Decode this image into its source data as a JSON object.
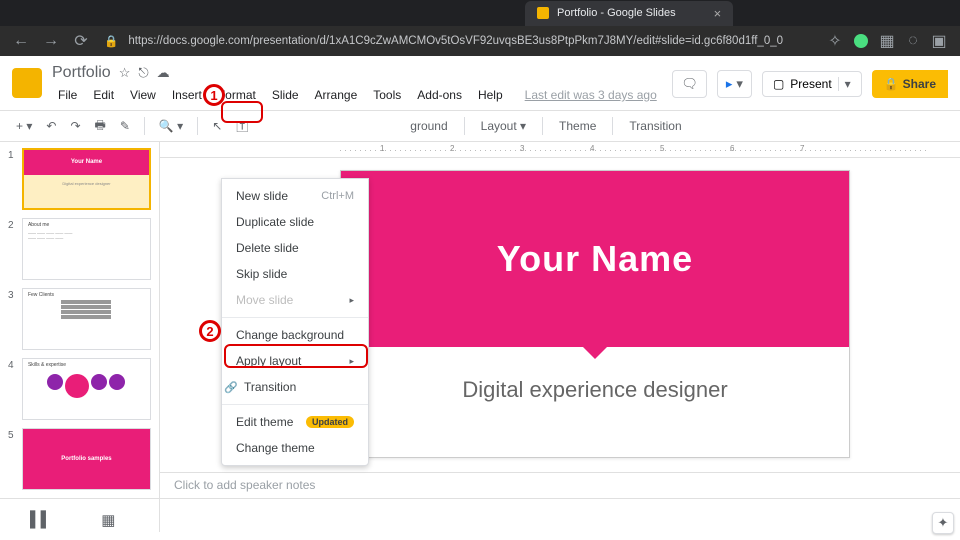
{
  "browser": {
    "tab_title": "Portfolio - Google Slides",
    "url": "https://docs.google.com/presentation/d/1xA1C9cZwAMCMOv5tOsVF92uvqsBE3us8PtpPkm7J8MY/edit#slide=id.gc6f80d1ff_0_0"
  },
  "app": {
    "doc_title": "Portfolio",
    "menus": [
      "File",
      "Edit",
      "View",
      "Insert",
      "Format",
      "Slide",
      "Arrange",
      "Tools",
      "Add-ons",
      "Help"
    ],
    "last_edit": "Last edit was 3 days ago",
    "present_label": "Present",
    "share_label": "Share"
  },
  "toolbar": {
    "background": "ground",
    "layout": "Layout",
    "theme": "Theme",
    "transition": "Transition"
  },
  "dropdown": {
    "new_slide": "New slide",
    "new_slide_shortcut": "Ctrl+M",
    "duplicate": "Duplicate slide",
    "delete": "Delete slide",
    "skip": "Skip slide",
    "move": "Move slide",
    "change_bg": "Change background",
    "apply_layout": "Apply layout",
    "transition": "Transition",
    "edit_theme": "Edit theme",
    "edit_theme_badge": "Updated",
    "change_theme": "Change theme"
  },
  "slide": {
    "title": "Your Name",
    "subtitle": "Digital experience designer"
  },
  "thumbs": {
    "t1_title": "Your Name",
    "t1_sub": "Digital experience designer",
    "t2_h": "About me",
    "t3_h": "Few Clients",
    "t4_h": "Skills & expertise",
    "t5_h": "Portfolio samples"
  },
  "notes_placeholder": "Click to add speaker notes",
  "annotations": {
    "a1": "1",
    "a2": "2"
  },
  "ruler_ticks": [
    "1",
    "2",
    "3",
    "4",
    "5",
    "6",
    "7"
  ]
}
